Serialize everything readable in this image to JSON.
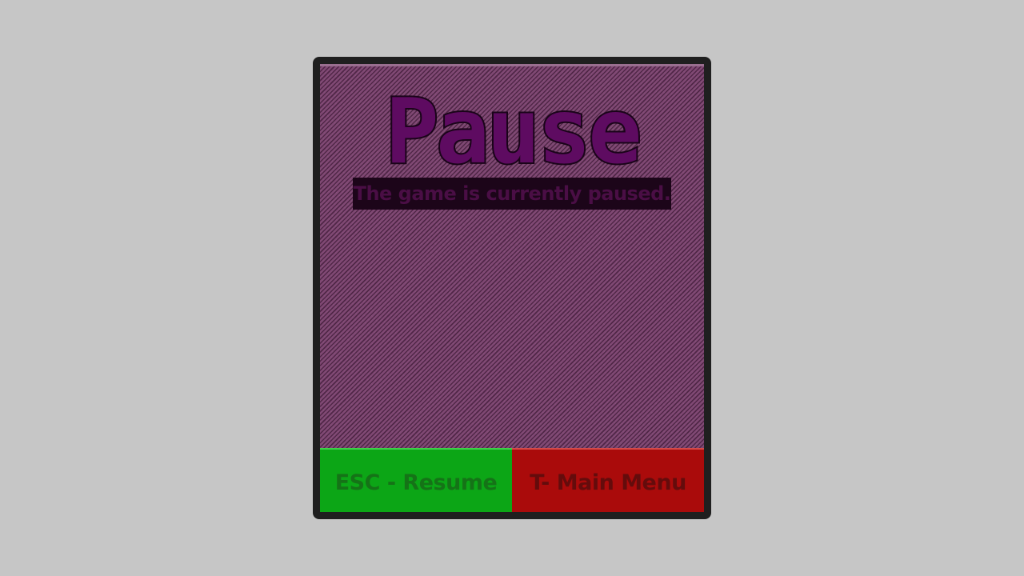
{
  "pause_menu": {
    "title": "Pause",
    "subtitle": "The game is currently paused.",
    "buttons": {
      "resume_label": "ESC - Resume",
      "main_menu_label": "T- Main Menu"
    }
  },
  "colors": {
    "background": "#c6c6c6",
    "window_frame": "#1f1f1f",
    "panel_pattern": "#7f4873",
    "title_fill": "#5e0b61",
    "subtitle_bar": "#1c0519",
    "resume_button": "#0ca616",
    "main_menu_button": "#aa0b0b"
  }
}
